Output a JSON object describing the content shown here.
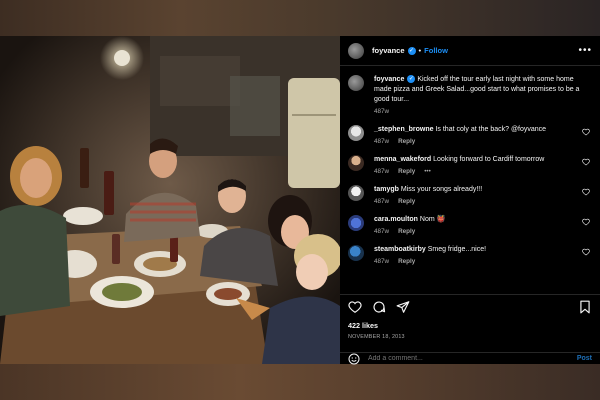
{
  "post": {
    "username": "foyvance",
    "follow_label": "Follow",
    "dot": "•",
    "more_label": "•••",
    "verified_mark": "✓"
  },
  "caption": {
    "username": "foyvance",
    "text": "Kicked off the tour early last night with some home made pizza and Greek Salad...good start to what promises to be a good tour...",
    "time": "487w"
  },
  "comments": [
    {
      "username": "_stephen_browne",
      "text": "Is that coly at the back? @foyvance",
      "time": "487w",
      "reply": "Reply",
      "extra": ""
    },
    {
      "username": "menna_wakeford",
      "text": "Looking forward to Cardiff tomorrow",
      "time": "487w",
      "reply": "Reply",
      "extra": "•••"
    },
    {
      "username": "tamygb",
      "text": "Miss your songs already!!!",
      "time": "487w",
      "reply": "Reply",
      "extra": ""
    },
    {
      "username": "cara.moulton",
      "text": "Nom 👹",
      "time": "487w",
      "reply": "Reply",
      "extra": ""
    },
    {
      "username": "steamboatkirby",
      "text": "Smeg fridge...nice!",
      "time": "487w",
      "reply": "Reply",
      "extra": ""
    }
  ],
  "stats": {
    "likes": "422 likes",
    "date": "NOVEMBER 18, 2013"
  },
  "add_comment": {
    "placeholder": "Add a comment...",
    "post_label": "Post"
  },
  "icons": [
    "more-icon",
    "heart-icon",
    "comment-icon",
    "share-icon",
    "save-icon",
    "emoji-icon",
    "verified-icon"
  ],
  "colors": {
    "accent": "#1d8ff5",
    "panel_bg": "#000000",
    "muted": "#a8a8a8"
  }
}
